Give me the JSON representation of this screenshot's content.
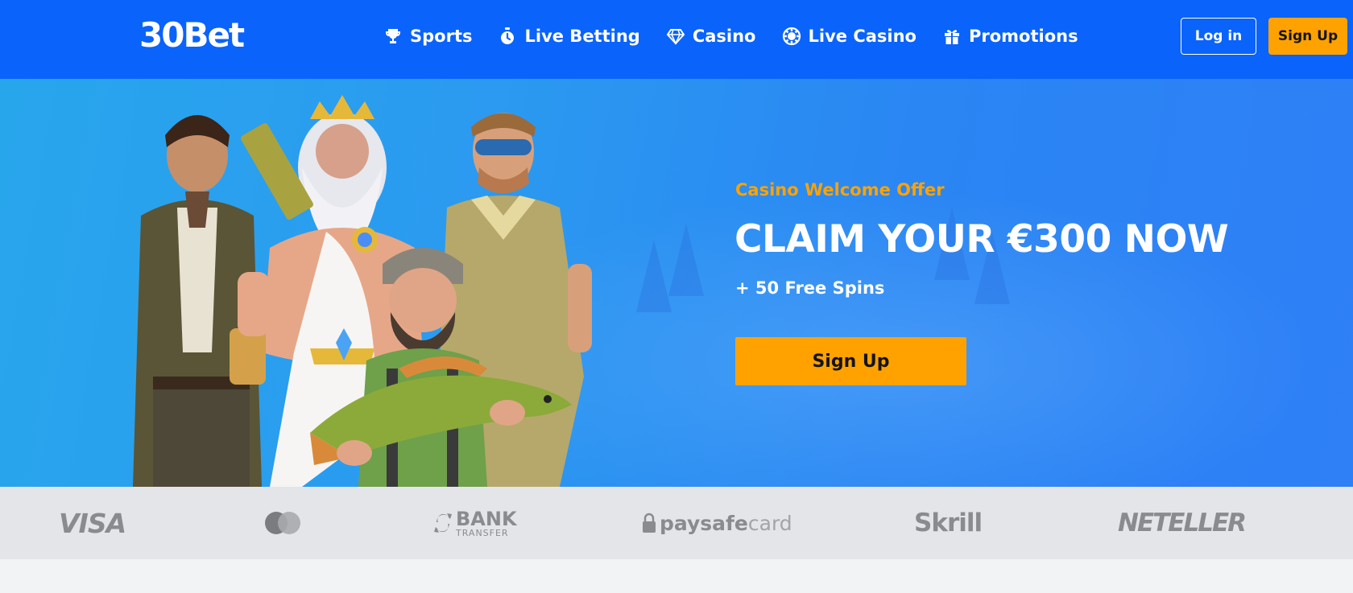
{
  "colors": {
    "header_bg": "#0a63fb",
    "accent": "#ffa200",
    "hero_bg": "#2a8ef0",
    "payments_bg": "#e4e5e8"
  },
  "header": {
    "logo": "30Bet",
    "nav": [
      {
        "label": "Sports",
        "icon": "trophy-icon"
      },
      {
        "label": "Live Betting",
        "icon": "stopwatch-icon"
      },
      {
        "label": "Casino",
        "icon": "diamond-icon"
      },
      {
        "label": "Live Casino",
        "icon": "casino-chip-icon"
      },
      {
        "label": "Promotions",
        "icon": "gift-icon"
      }
    ],
    "login_label": "Log in",
    "signup_label": "Sign Up"
  },
  "hero": {
    "tag": "Casino Welcome Offer",
    "title": "CLAIM YOUR €300 NOW",
    "subtitle": "+ 50 Free Spins",
    "cta_label": "Sign Up"
  },
  "payments": {
    "visa": "VISA",
    "mastercard": "mastercard-icon",
    "bank_big": "BANK",
    "bank_small": "TRANSFER",
    "paysafe_bold": "paysafe",
    "paysafe_light": "card",
    "skrill": "Skrill",
    "neteller": "NETELLER"
  }
}
